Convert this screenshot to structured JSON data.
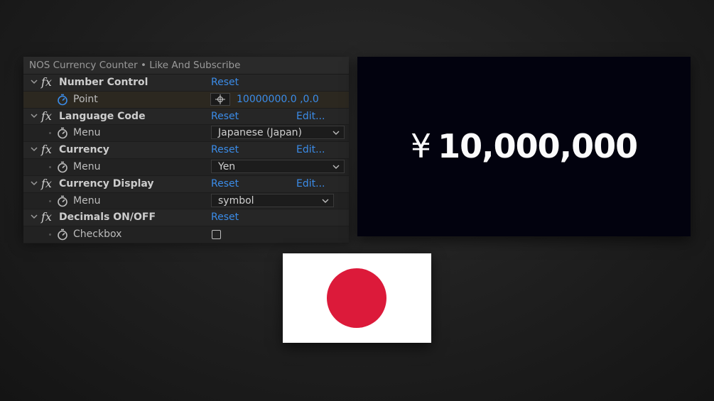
{
  "panel": {
    "title": "NOS Currency Counter • Like And Subscribe",
    "effects": [
      {
        "name": "Number Control",
        "reset": "Reset",
        "property": {
          "name": "Point",
          "value": "10000000.0 ,0.0"
        }
      },
      {
        "name": "Language Code",
        "reset": "Reset",
        "edit": "Edit...",
        "property": {
          "name": "Menu",
          "value": "Japanese (Japan)"
        }
      },
      {
        "name": "Currency",
        "reset": "Reset",
        "edit": "Edit...",
        "property": {
          "name": "Menu",
          "value": "Yen"
        }
      },
      {
        "name": "Currency Display",
        "reset": "Reset",
        "edit": "Edit...",
        "property": {
          "name": "Menu",
          "value": "symbol"
        }
      },
      {
        "name": "Decimals ON/OFF",
        "reset": "Reset",
        "property": {
          "name": "Checkbox",
          "checked": false
        }
      }
    ],
    "fx_label": "fx"
  },
  "preview": {
    "currency_symbol": "¥",
    "amount": "10,000,000"
  },
  "flag": {
    "country": "Japan",
    "disc_color": "#dc1a3a",
    "field_color": "#ffffff"
  },
  "colors": {
    "link": "#3b8ce8",
    "preview_bg": "#02020e"
  },
  "icons": {
    "expand": "chevron-down-icon",
    "stopwatch": "stopwatch-icon",
    "point": "crosshair-icon",
    "dropdown": "chevron-down-icon"
  }
}
